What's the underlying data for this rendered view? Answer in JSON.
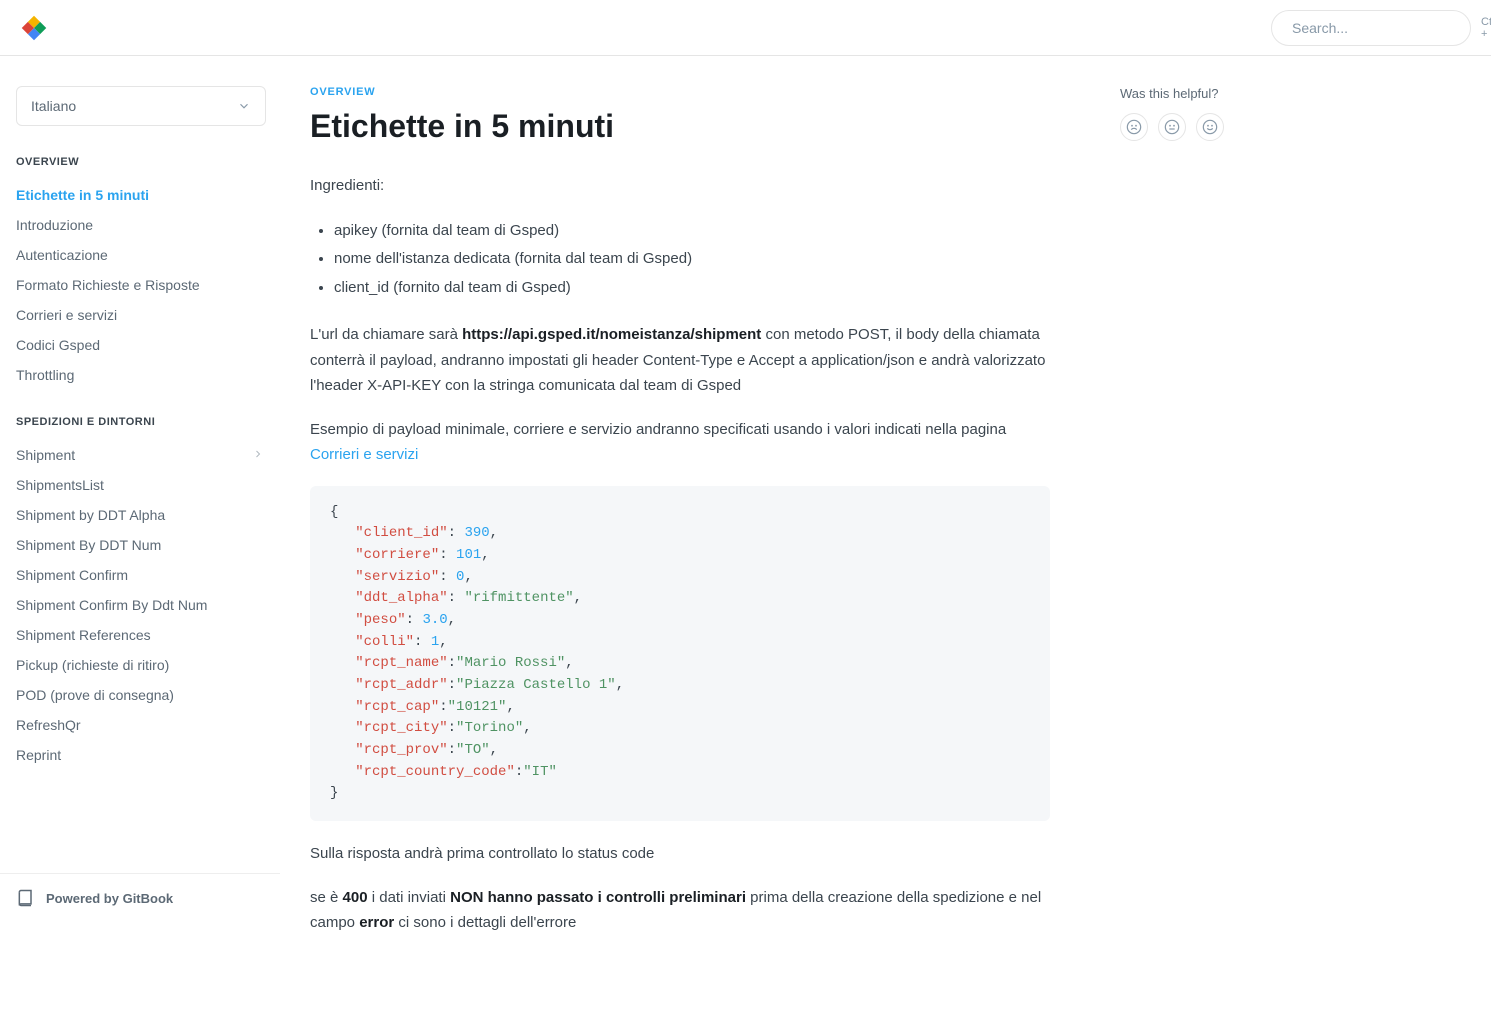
{
  "search": {
    "placeholder": "Search...",
    "shortcut": "Ctrl + K"
  },
  "language": {
    "selected": "Italiano"
  },
  "sidebar": {
    "sections": [
      {
        "heading": "OVERVIEW",
        "items": [
          {
            "label": "Etichette in 5 minuti",
            "active": true
          },
          {
            "label": "Introduzione"
          },
          {
            "label": "Autenticazione"
          },
          {
            "label": "Formato Richieste e Risposte"
          },
          {
            "label": "Corrieri e servizi"
          },
          {
            "label": "Codici Gsped"
          },
          {
            "label": "Throttling"
          }
        ]
      },
      {
        "heading": "SPEDIZIONI E DINTORNI",
        "items": [
          {
            "label": "Shipment",
            "expandable": true
          },
          {
            "label": "ShipmentsList"
          },
          {
            "label": "Shipment by DDT Alpha"
          },
          {
            "label": "Shipment By DDT Num"
          },
          {
            "label": "Shipment Confirm"
          },
          {
            "label": "Shipment Confirm By Ddt Num"
          },
          {
            "label": "Shipment References"
          },
          {
            "label": "Pickup (richieste di ritiro)"
          },
          {
            "label": "POD (prove di consegna)"
          },
          {
            "label": "RefreshQr"
          },
          {
            "label": "Reprint"
          }
        ]
      }
    ]
  },
  "powered_by": "Powered by GitBook",
  "article": {
    "eyebrow": "OVERVIEW",
    "title": "Etichette in 5 minuti",
    "p_ingredients": "Ingredienti:",
    "ingredients": [
      "apikey (fornita dal team di Gsped)",
      "nome dell'istanza dedicata (fornita dal team di Gsped)",
      "client_id (fornito dal team di Gsped)"
    ],
    "p_url_pre": "L'url da chiamare sarà ",
    "p_url_bold": "https://api.gsped.it/nomeistanza/shipment",
    "p_url_post": " con metodo POST, il body della chiamata conterrà il payload, andranno impostati gli header Content-Type e Accept a application/json e andrà valorizzato l'header X-API-KEY con la stringa comunicata dal team di Gsped",
    "p_example_pre": "Esempio di payload minimale, corriere e servizio andranno specificati usando i valori indicati nella pagina ",
    "p_example_link": "Corrieri e servizi",
    "code": {
      "lines": [
        {
          "indent": 0,
          "plain": "{"
        },
        {
          "indent": 1,
          "key": "\"client_id\"",
          "sep": ": ",
          "val": "390",
          "valtype": "num",
          "tail": ","
        },
        {
          "indent": 1,
          "key": "\"corriere\"",
          "sep": ": ",
          "val": "101",
          "valtype": "num",
          "tail": ","
        },
        {
          "indent": 1,
          "key": "\"servizio\"",
          "sep": ": ",
          "val": "0",
          "valtype": "num",
          "tail": ","
        },
        {
          "indent": 1,
          "key": "\"ddt_alpha\"",
          "sep": ": ",
          "val": "\"rifmittente\"",
          "valtype": "str",
          "tail": ","
        },
        {
          "indent": 1,
          "key": "\"peso\"",
          "sep": ": ",
          "val": "3.0",
          "valtype": "num",
          "tail": ","
        },
        {
          "indent": 1,
          "key": "\"colli\"",
          "sep": ": ",
          "val": "1",
          "valtype": "num",
          "tail": ","
        },
        {
          "indent": 1,
          "key": "\"rcpt_name\"",
          "sep": ":",
          "val": "\"Mario Rossi\"",
          "valtype": "str",
          "tail": ","
        },
        {
          "indent": 1,
          "key": "\"rcpt_addr\"",
          "sep": ":",
          "val": "\"Piazza Castello 1\"",
          "valtype": "str",
          "tail": ","
        },
        {
          "indent": 1,
          "key": "\"rcpt_cap\"",
          "sep": ":",
          "val": "\"10121\"",
          "valtype": "str",
          "tail": ","
        },
        {
          "indent": 1,
          "key": "\"rcpt_city\"",
          "sep": ":",
          "val": "\"Torino\"",
          "valtype": "str",
          "tail": ","
        },
        {
          "indent": 1,
          "key": "\"rcpt_prov\"",
          "sep": ":",
          "val": "\"TO\"",
          "valtype": "str",
          "tail": ","
        },
        {
          "indent": 1,
          "key": "\"rcpt_country_code\"",
          "sep": ":",
          "val": "\"IT\"",
          "valtype": "str",
          "tail": ""
        },
        {
          "indent": 0,
          "plain": "}"
        }
      ]
    },
    "p_status": "Sulla risposta andrà prima controllato lo status code",
    "p_400_pre": "se è ",
    "p_400_b1": "400",
    "p_400_mid": " i dati inviati ",
    "p_400_b2": "NON hanno passato i controlli preliminari",
    "p_400_post1": " prima della creazione della spedizione e nel campo ",
    "p_400_b3": "error",
    "p_400_post2": " ci sono i dettagli dell'errore"
  },
  "feedback": {
    "label": "Was this helpful?"
  }
}
